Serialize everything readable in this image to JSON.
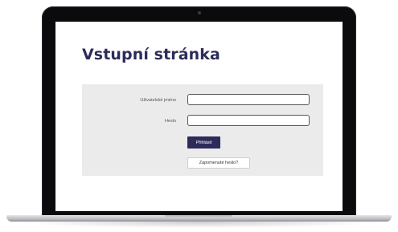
{
  "page": {
    "title": "Vstupní stránka"
  },
  "login_form": {
    "username_label": "Uživatelské jméno",
    "username_value": "",
    "password_label": "Heslo",
    "password_value": "",
    "submit_label": "Přihlásit",
    "forgot_label": "Zapomenuté heslo?"
  },
  "colors": {
    "brand": "#2c2c5b",
    "panel_background": "#ebebeb",
    "laptop_bezel": "#0b0b0d"
  }
}
